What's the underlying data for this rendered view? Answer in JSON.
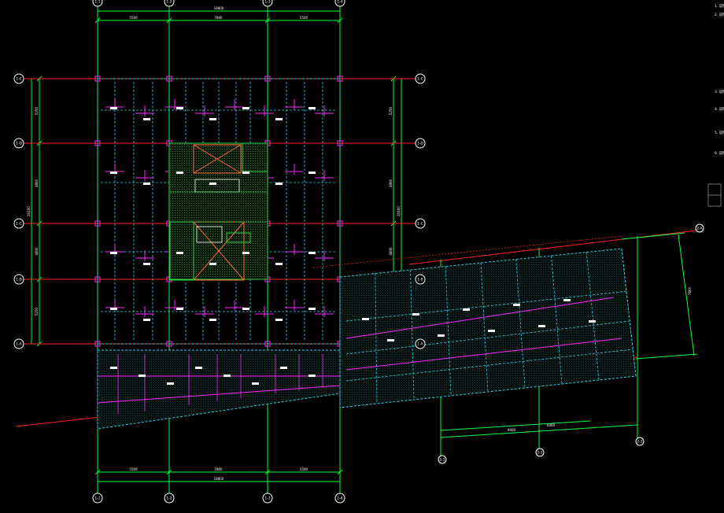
{
  "drawing": {
    "background": "#000000",
    "colors": {
      "axis_green": "#00ff3a",
      "axis_red": "#ff2020",
      "cyan_beam": "#27d3e6",
      "magenta_beam": "#ff26ff",
      "white": "#ffffff",
      "bubble_outline": "#ffffff",
      "orange_core": "#ff6a2a",
      "green_core": "#29d33a",
      "dim_gray": "#6e6e6e"
    },
    "grid_labels_top": [
      "1-1",
      "1-2",
      "1-3",
      "1-4"
    ],
    "grid_labels_bottom": [
      "1-1",
      "1-2",
      "1-3",
      "1-4"
    ],
    "grid_labels_left": [
      "1-E",
      "1-D",
      "1-C",
      "1-B",
      "1-A"
    ],
    "grid_labels_right": [
      "1-E",
      "1-D",
      "1-C",
      "1-B",
      "1-A"
    ],
    "wing_labels_bottom": [
      "2-1",
      "2-2",
      "2-3"
    ],
    "wing_labels_right": [
      "2-A"
    ],
    "dims_top_segments": [
      "5500",
      "7800",
      "5500"
    ],
    "dims_top_total": "18800",
    "dims_bottom_segments": [
      "5500",
      "7800",
      "5500"
    ],
    "dims_bottom_total": "18800",
    "dims_left_segments": [
      "5250",
      "4800",
      "4800",
      "5250"
    ],
    "dims_left_total": "20100",
    "dims_right_segments": [
      "5250",
      "4800",
      "4800",
      "5250"
    ],
    "dims_right_total": "20100",
    "wing_dim_bottom": [
      "9000",
      "6000"
    ],
    "wing_dim_right": "7800",
    "side_notes": [
      "1. 说明",
      "2. 说明",
      "3. 说明",
      "4. 说明",
      "5. 说明",
      "6. 说明"
    ]
  }
}
